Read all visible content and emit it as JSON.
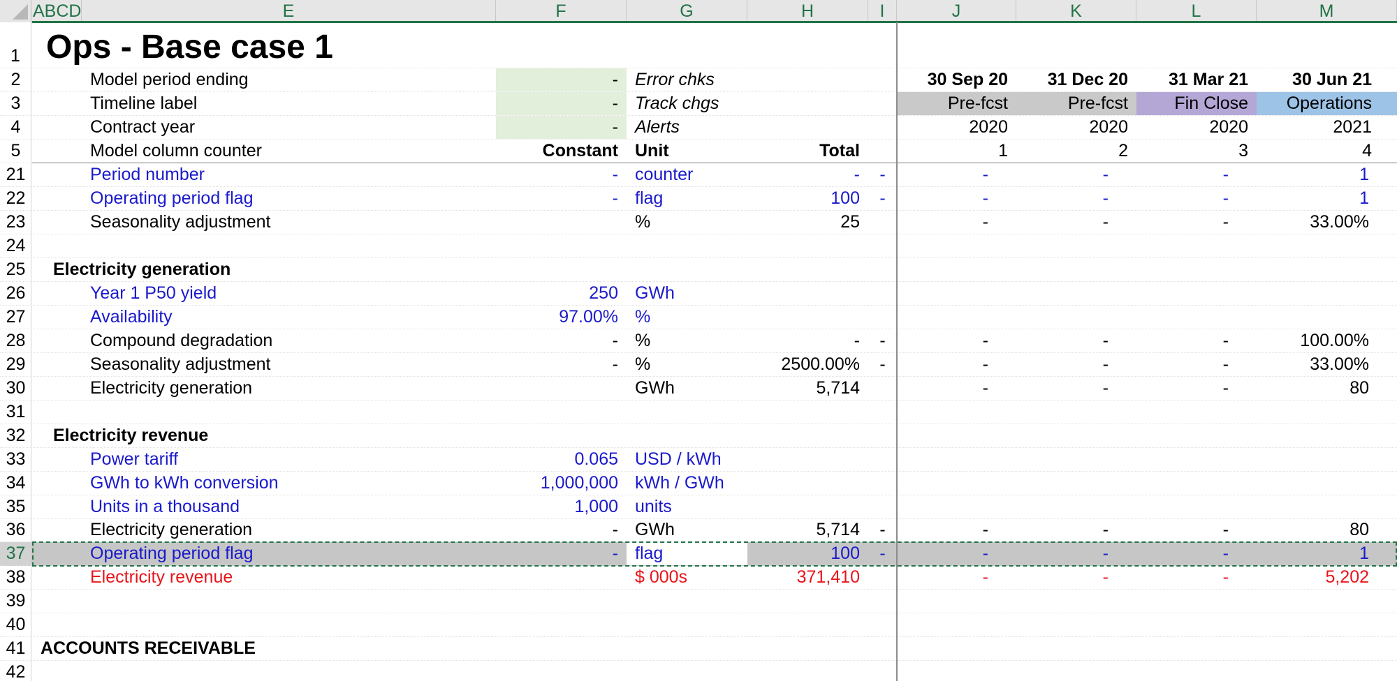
{
  "column_headers": [
    "ABCD",
    "E",
    "F",
    "G",
    "H",
    "I",
    "J",
    "K",
    "L",
    "M"
  ],
  "title": "Ops - Base case 1",
  "rows": {
    "r2": {
      "num": "2",
      "label": "Model period ending",
      "F": "-",
      "G": "Error chks",
      "J": "30 Sep 20",
      "K": "31 Dec 20",
      "L": "31 Mar 21",
      "M": "30 Jun 21"
    },
    "r3": {
      "num": "3",
      "label": "Timeline label",
      "F": "-",
      "G": "Track chgs",
      "J": "Pre-fcst",
      "K": "Pre-fcst",
      "L": "Fin Close",
      "M": "Operations"
    },
    "r4": {
      "num": "4",
      "label": "Contract year",
      "F": "-",
      "G": "Alerts",
      "J": "2020",
      "K": "2020",
      "L": "2020",
      "M": "2021"
    },
    "r5": {
      "num": "5",
      "label": "Model column counter",
      "F": "Constant",
      "G": "Unit",
      "H": "Total",
      "J": "1",
      "K": "2",
      "L": "3",
      "M": "4"
    },
    "r21": {
      "num": "21",
      "label": "Period number",
      "F": "-",
      "G": "counter",
      "H": "-",
      "I": "-",
      "J": "-",
      "K": "-",
      "L": "-",
      "M": "1"
    },
    "r22": {
      "num": "22",
      "label": "Operating period flag",
      "F": "-",
      "G": "flag",
      "H": "100",
      "I": "-",
      "J": "-",
      "K": "-",
      "L": "-",
      "M": "1"
    },
    "r23": {
      "num": "23",
      "label": "Seasonality adjustment",
      "G": "%",
      "H": "25",
      "J": "-",
      "K": "-",
      "L": "-",
      "M": "33.00%"
    },
    "r24": {
      "num": "24"
    },
    "r25": {
      "num": "25",
      "label": "Electricity generation"
    },
    "r26": {
      "num": "26",
      "label": "Year 1 P50 yield",
      "F": "250",
      "G": "GWh"
    },
    "r27": {
      "num": "27",
      "label": "Availability",
      "F": "97.00%",
      "G": "%"
    },
    "r28": {
      "num": "28",
      "label": "Compound degradation",
      "F": "-",
      "G": "%",
      "H": "-",
      "I": "-",
      "J": "-",
      "K": "-",
      "L": "-",
      "M": "100.00%"
    },
    "r29": {
      "num": "29",
      "label": "Seasonality adjustment",
      "F": "-",
      "G": "%",
      "H": "2500.00%",
      "I": "-",
      "J": "-",
      "K": "-",
      "L": "-",
      "M": "33.00%"
    },
    "r30": {
      "num": "30",
      "label": "Electricity generation",
      "G": "GWh",
      "H": "5,714",
      "J": "-",
      "K": "-",
      "L": "-",
      "M": "80"
    },
    "r31": {
      "num": "31"
    },
    "r32": {
      "num": "32",
      "label": "Electricity revenue"
    },
    "r33": {
      "num": "33",
      "label": "Power tariff",
      "F": "0.065",
      "G": "USD / kWh"
    },
    "r34": {
      "num": "34",
      "label": "GWh to kWh conversion",
      "F": "1,000,000",
      "G": "kWh / GWh"
    },
    "r35": {
      "num": "35",
      "label": "Units in a thousand",
      "F": "1,000",
      "G": "units"
    },
    "r36": {
      "num": "36",
      "label": "Electricity generation",
      "F": "-",
      "G": "GWh",
      "H": "5,714",
      "I": "-",
      "J": "-",
      "K": "-",
      "L": "-",
      "M": "80"
    },
    "r37": {
      "num": "37",
      "label": "Operating period flag",
      "F": "-",
      "G": "flag",
      "H": "100",
      "I": "-",
      "J": "-",
      "K": "-",
      "L": "-",
      "M": "1"
    },
    "r38": {
      "num": "38",
      "label": "Electricity revenue",
      "G": "$ 000s",
      "H": "371,410",
      "J": "-",
      "K": "-",
      "L": "-",
      "M": "5,202"
    },
    "r39": {
      "num": "39"
    },
    "r40": {
      "num": "40"
    },
    "r41": {
      "num": "41",
      "label": "ACCOUNTS RECEIVABLE"
    },
    "r42": {
      "num": "42"
    }
  },
  "row1_num": "1",
  "selected_row": "37",
  "colors": {
    "header_accent": "#217346",
    "input_fill": "#e2efda",
    "prefcst_fill": "#c9c9c9",
    "finclose_fill": "#b4a7d6",
    "operations_fill": "#9dc3e6",
    "input_text": "#1a1acc",
    "output_text": "#e8141a"
  }
}
